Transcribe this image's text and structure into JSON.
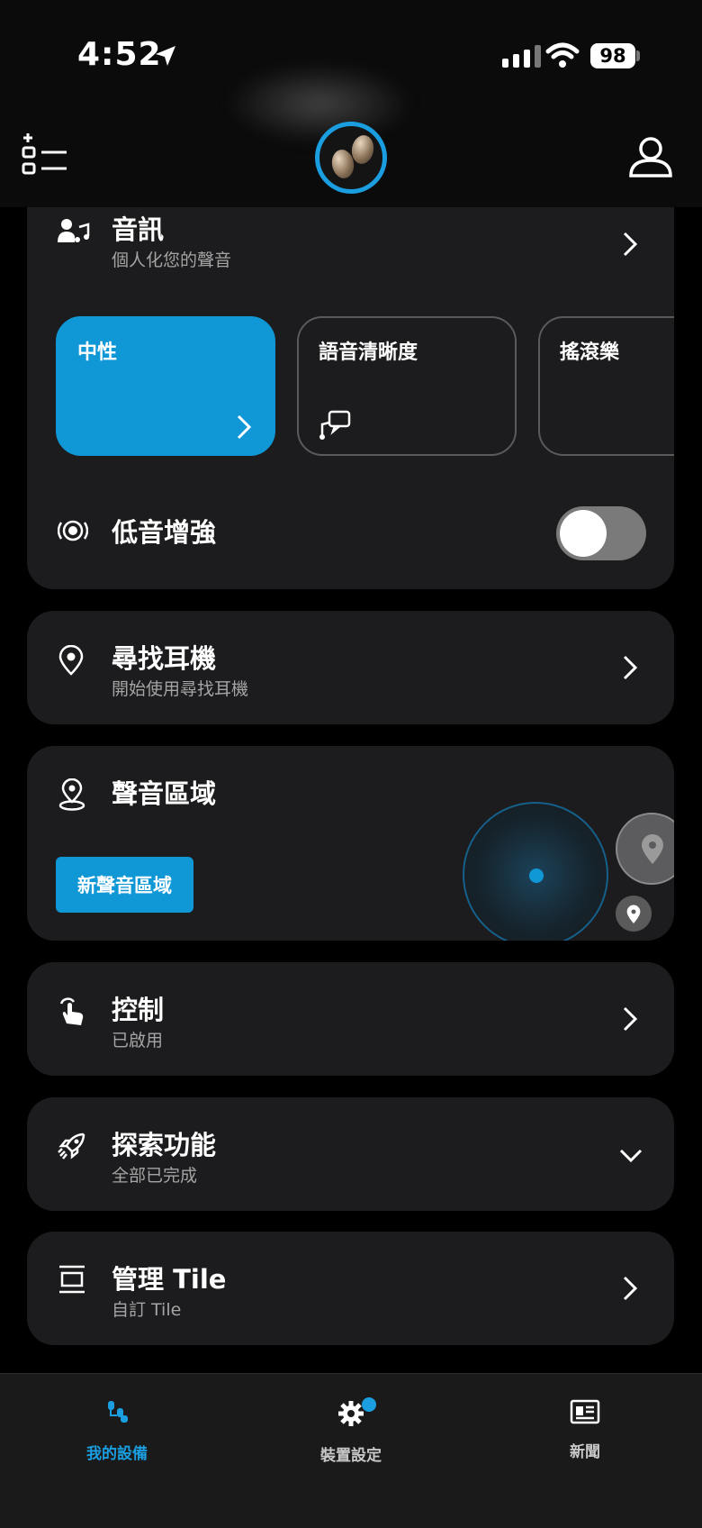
{
  "status_bar": {
    "time": "4:52",
    "battery": "98"
  },
  "audio": {
    "title": "音訊",
    "subtitle": "個人化您的聲音",
    "presets": [
      "中性",
      "語音清晰度",
      "搖滾樂"
    ],
    "bass_boost_label": "低音增強",
    "bass_boost_enabled": false
  },
  "find_earbuds": {
    "title": "尋找耳機",
    "subtitle": "開始使用尋找耳機"
  },
  "sound_zones": {
    "title": "聲音區域",
    "button_label": "新聲音區域"
  },
  "controls": {
    "title": "控制",
    "subtitle": "已啟用"
  },
  "explore": {
    "title": "探索功能",
    "subtitle": "全部已完成"
  },
  "tiles": {
    "title": "管理 Tile",
    "subtitle": "自訂 Tile"
  },
  "bottom_nav": {
    "items": [
      {
        "label": "我的設備",
        "icon": "devices-icon",
        "active": true
      },
      {
        "label": "裝置設定",
        "icon": "gear-icon",
        "badge": true
      },
      {
        "label": "新聞",
        "icon": "news-icon"
      }
    ]
  },
  "colors": {
    "accent": "#0f97d6",
    "card": "#1c1c1e",
    "background": "#000000"
  }
}
